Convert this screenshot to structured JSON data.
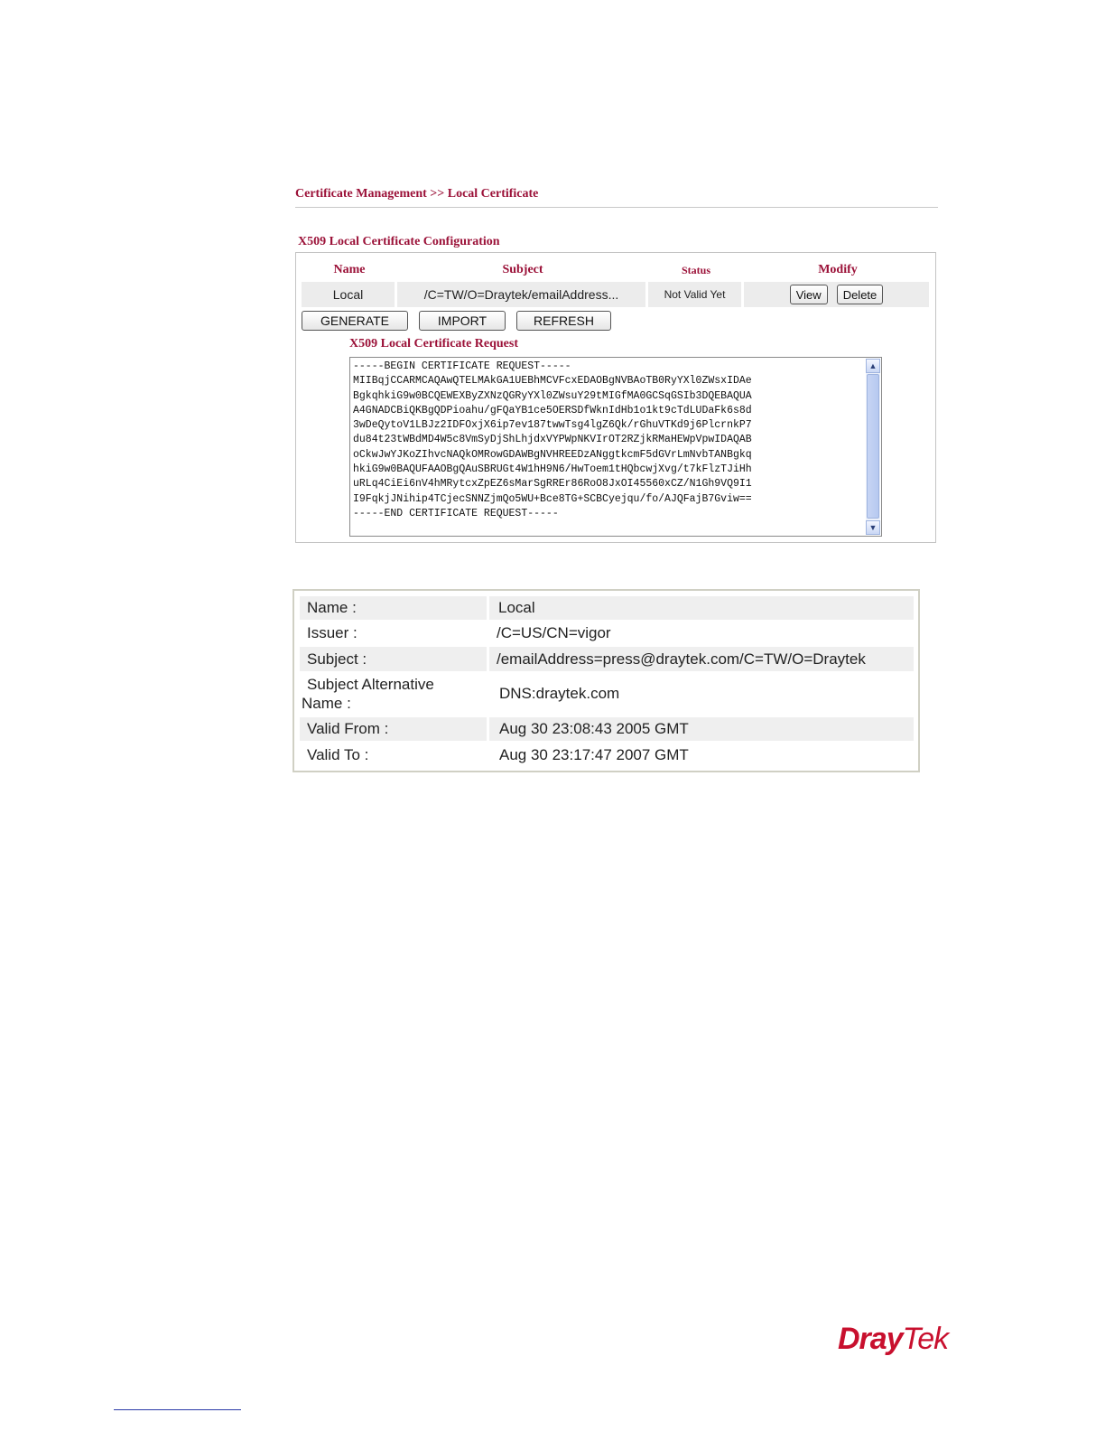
{
  "breadcrumb": "Certificate Management >> Local Certificate",
  "config": {
    "title": "X509 Local Certificate Configuration",
    "headers": {
      "name": "Name",
      "subject": "Subject",
      "status": "Status",
      "modify": "Modify"
    },
    "row": {
      "name": "Local",
      "subject": "/C=TW/O=Draytek/emailAddress...",
      "status": "Not Valid Yet",
      "view_label": "View",
      "delete_label": "Delete"
    },
    "buttons": {
      "generate": "GENERATE",
      "import": "IMPORT",
      "refresh": "REFRESH"
    }
  },
  "request": {
    "title": "X509 Local Certificate Request",
    "text": "-----BEGIN CERTIFICATE REQUEST-----\nMIIBqjCCARMCAQAwQTELMAkGA1UEBhMCVFcxEDAOBgNVBAoTB0RyYXl0ZWsxIDAe\nBgkqhkiG9w0BCQEWEXByZXNzQGRyYXl0ZWsuY29tMIGfMA0GCSqGSIb3DQEBAQUA\nA4GNADCBiQKBgQDPioahu/gFQaYB1ce5OERSDfWknIdHb1o1kt9cTdLUDaFk6s8d\n3wDeQytoV1LBJz2IDFOxjX6ip7ev187twwTsg4lgZ6Qk/rGhuVTKd9j6PlcrnkP7\ndu84t23tWBdMD4W5c8VmSyDjShLhjdxVYPWpNKVIrOT2RZjkRMaHEWpVpwIDAQAB\noCkwJwYJKoZIhvcNAQkOMRowGDAWBgNVHREEDzANggtkcmF5dGVrLmNvbTANBgkq\nhkiG9w0BAQUFAAOBgQAuSBRUGt4W1hH9N6/HwToem1tHQbcwjXvg/t7kFlzTJiHh\nuRLq4CiEi6nV4hMRytcxZpEZ6sMarSgRREr86RoO8JxOI45560xCZ/N1Gh9VQ9I1\nI9FqkjJNihip4TCjecSNNZjmQo5WU+Bce8TG+SCBCyejqu/fo/AJQFajB7Gviw==\n-----END CERTIFICATE REQUEST-----"
  },
  "details": {
    "name_label": "Name :",
    "name_value": "Local",
    "issuer_label": "Issuer :",
    "issuer_value": "/C=US/CN=vigor",
    "subject_label": "Subject :",
    "subject_value": "/emailAddress=press@draytek.com/C=TW/O=Draytek",
    "san_label_line1": "Subject Alternative",
    "san_label_line2": "Name :",
    "san_value": "DNS:draytek.com",
    "valid_from_label": "Valid From :",
    "valid_from_value": "Aug 30 23:08:43 2005 GMT",
    "valid_to_label": "Valid To :",
    "valid_to_value": "Aug 30 23:17:47 2007 GMT"
  },
  "logo": {
    "part1": "Dray",
    "part2": "Tek",
    "color": "#c8102e"
  },
  "colors": {
    "accent": "#9b1138"
  }
}
